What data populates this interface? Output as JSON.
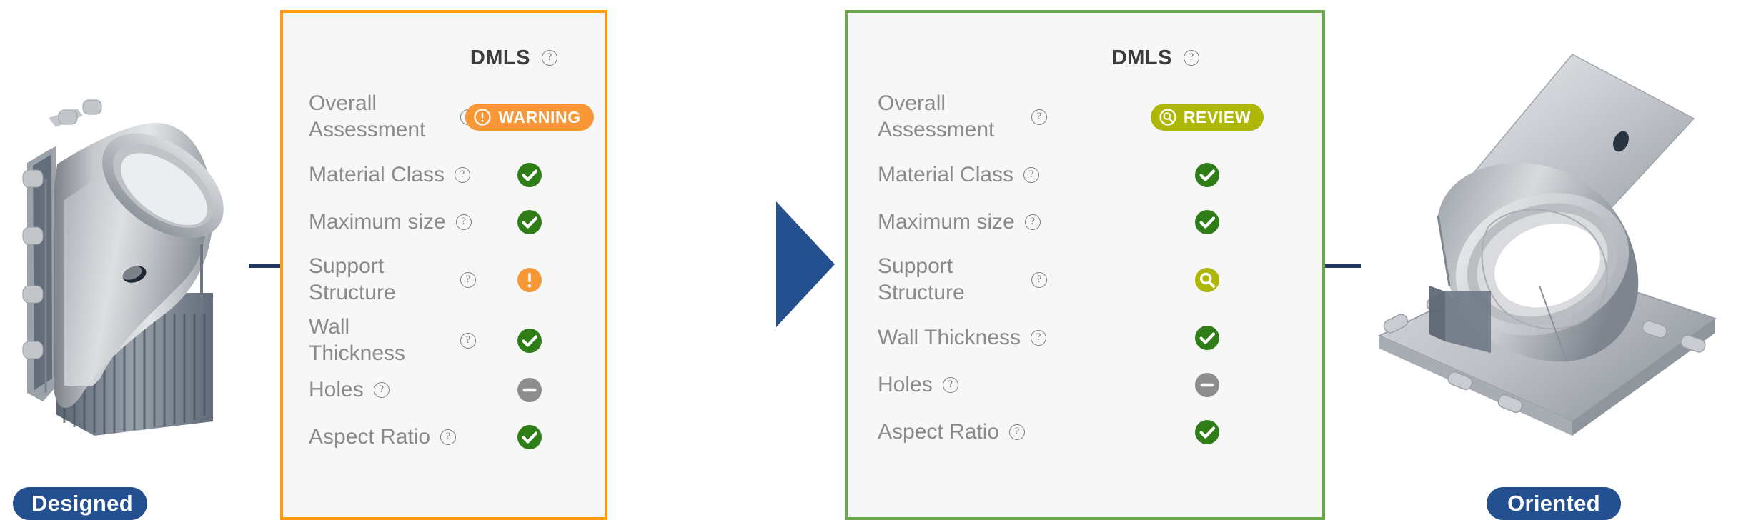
{
  "left_model": {
    "label": "Designed",
    "icon": "3d-part-model-designed"
  },
  "right_model": {
    "label": "Oriented",
    "icon": "3d-part-model-oriented"
  },
  "flow_arrow": {
    "icon": "right-triangle-arrow",
    "color": "#24508F"
  },
  "colors": {
    "panel_background": "#F7F7F7",
    "left_panel_border": "#FF9B11",
    "right_panel_border": "#69A94B",
    "pill_blue": "#24508F",
    "warning_orange": "#F79736",
    "review_olive": "#AFB706",
    "pass_green": "#2E7D16",
    "na_gray": "#8D8D8D",
    "label_gray": "#8A8A8A",
    "connector_navy": "#1F3864"
  },
  "left_panel": {
    "process": "DMLS",
    "process_help_icon": "help-circle-icon",
    "border_color": "#FF9B11",
    "rows": [
      {
        "label": "Overall Assessment",
        "help_icon": "help-circle-icon",
        "status": "warning",
        "status_icon": "exclamation-circle-icon",
        "badge_label": "WARNING"
      },
      {
        "label": "Material Class",
        "help_icon": "help-circle-icon",
        "status": "pass",
        "status_icon": "check-circle-icon"
      },
      {
        "label": "Maximum size",
        "help_icon": "help-circle-icon",
        "status": "pass",
        "status_icon": "check-circle-icon"
      },
      {
        "label": "Support Structure",
        "help_icon": "help-circle-icon",
        "status": "warning",
        "status_icon": "exclamation-circle-icon"
      },
      {
        "label": "Wall Thickness",
        "help_icon": "help-circle-icon",
        "status": "pass",
        "status_icon": "check-circle-icon"
      },
      {
        "label": "Holes",
        "help_icon": "help-circle-icon",
        "status": "not-applicable",
        "status_icon": "minus-circle-icon"
      },
      {
        "label": "Aspect Ratio",
        "help_icon": "help-circle-icon",
        "status": "pass",
        "status_icon": "check-circle-icon"
      }
    ]
  },
  "right_panel": {
    "process": "DMLS",
    "process_help_icon": "help-circle-icon",
    "border_color": "#69A94B",
    "rows": [
      {
        "label": "Overall Assessment",
        "help_icon": "help-circle-icon",
        "status": "review",
        "status_icon": "magnifier-circle-icon",
        "badge_label": "REVIEW"
      },
      {
        "label": "Material Class",
        "help_icon": "help-circle-icon",
        "status": "pass",
        "status_icon": "check-circle-icon"
      },
      {
        "label": "Maximum size",
        "help_icon": "help-circle-icon",
        "status": "pass",
        "status_icon": "check-circle-icon"
      },
      {
        "label": "Support Structure",
        "help_icon": "help-circle-icon",
        "status": "review",
        "status_icon": "magnifier-circle-icon"
      },
      {
        "label": "Wall Thickness",
        "help_icon": "help-circle-icon",
        "status": "pass",
        "status_icon": "check-circle-icon"
      },
      {
        "label": "Holes",
        "help_icon": "help-circle-icon",
        "status": "not-applicable",
        "status_icon": "minus-circle-icon"
      },
      {
        "label": "Aspect Ratio",
        "help_icon": "help-circle-icon",
        "status": "pass",
        "status_icon": "check-circle-icon"
      }
    ]
  }
}
